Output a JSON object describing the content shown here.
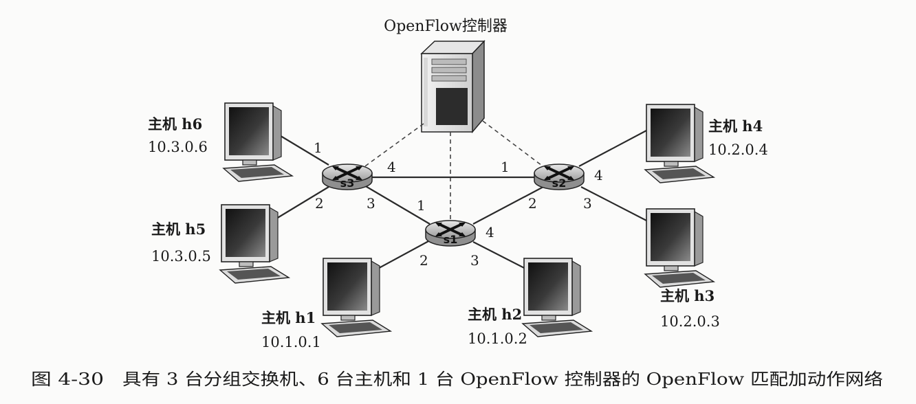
{
  "controller": {
    "title": "OpenFlow控制器"
  },
  "switches": [
    {
      "label": "s1"
    },
    {
      "label": "s2"
    },
    {
      "label": "s3"
    }
  ],
  "hosts": [
    {
      "label": "主机 h1",
      "ip": "10.1.0.1"
    },
    {
      "label": "主机 h2",
      "ip": "10.1.0.2"
    },
    {
      "label": "主机 h3",
      "ip": "10.2.0.3"
    },
    {
      "label": "主机 h4",
      "ip": "10.2.0.4"
    },
    {
      "label": "主机 h5",
      "ip": "10.3.0.5"
    },
    {
      "label": "主机 h6",
      "ip": "10.3.0.6"
    }
  ],
  "ports": {
    "s3_h6": "1",
    "s3_h5": "2",
    "s3_s2": "4",
    "s3_s1": "3",
    "s2_s3": "1",
    "s2_s1": "2",
    "s2_h4": "4",
    "s2_h3": "3",
    "s1_s3": "1",
    "s1_s2": "4",
    "s1_h1": "2",
    "s1_h2": "3"
  },
  "caption": {
    "figure": "图 4-30",
    "text": "具有 3 台分组交换机、6 台主机和 1 台 OpenFlow 控制器的 OpenFlow 匹配加动作网络"
  }
}
